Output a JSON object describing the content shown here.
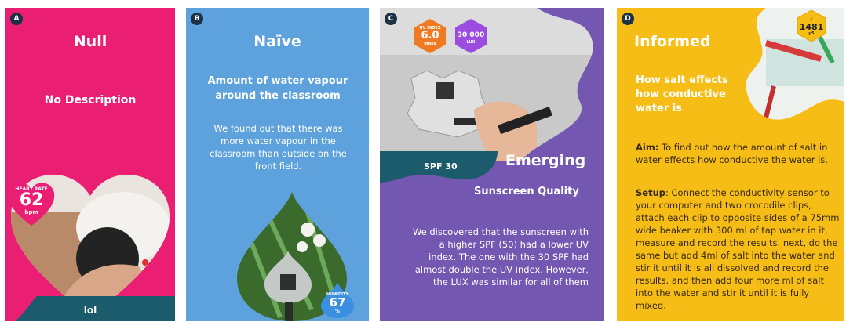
{
  "cards": [
    {
      "letter": "A",
      "title": "Null",
      "subtitle": "No Description",
      "badge_label": "HEART RATE",
      "badge_value": "62",
      "badge_unit": "bpm",
      "footer": "lol",
      "color": "#ea1f74"
    },
    {
      "letter": "B",
      "title": "Naïve",
      "subtitle": "Amount of water vapour around the classroom",
      "body": "We found out that there was more water vapour in the classroom than outside on the front field.",
      "badge_label": "HUMIDITY",
      "badge_value": "67",
      "badge_unit": "%",
      "color": "#5da2dc"
    },
    {
      "letter": "C",
      "title": "Emerging",
      "subtitle": "Sunscreen Quality",
      "body": "We discovered that the sunscreen with a higher SPF (50) had a lower UV index. The one with the 30 SPF had almost double the UV index. However, the LUX was similar for all of them",
      "tag": "SPF 30",
      "badge1_label": "UV INDEX",
      "badge1_value": "6.0",
      "badge1_unit": "index",
      "badge2_value": "30 000",
      "badge2_unit": "LUX",
      "color": "#7357b0"
    },
    {
      "letter": "D",
      "title": "Informed",
      "subtitle": "How salt effects how conductive water is",
      "aim_label": "Aim:",
      "aim_text": " To find out how the amount of salt in water effects how conductive the water is.",
      "setup_label": "Setup",
      "setup_text": ": Connect the conductivity sensor to your computer and  two crocodile clips, attach each clip to opposite sides of a 75mm wide beaker with 300 ml of tap water in it, measure  and record the results. next, do the same but add 4ml of salt into the water and stir it until it is all dissolved and record the results. and then add four more ml of salt into the water and stir it until it is  fully  mixed.",
      "badge_value": "1481",
      "badge_unit": "µS",
      "color": "#f6bd16"
    }
  ]
}
